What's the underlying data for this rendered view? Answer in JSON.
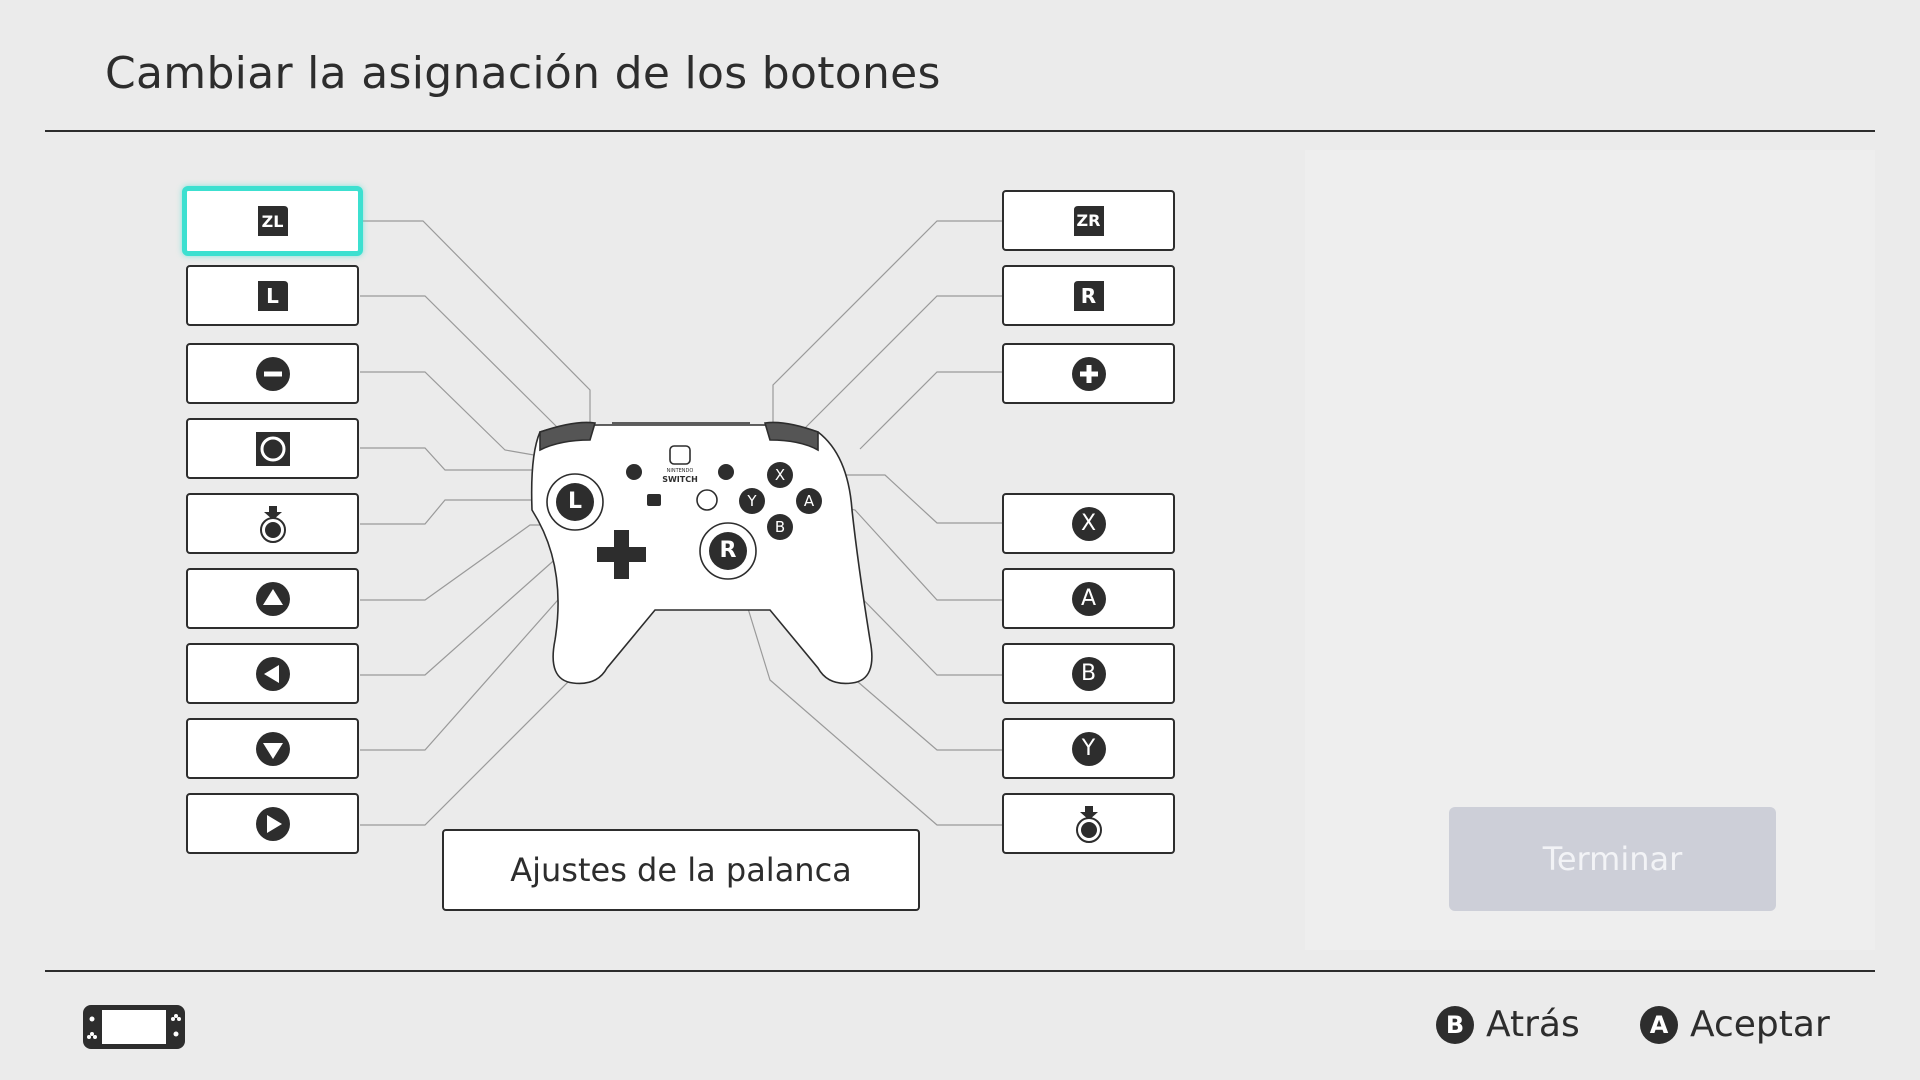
{
  "header": {
    "title": "Cambiar la asignación de los botones"
  },
  "left_buttons": [
    {
      "icon": "zl-button-icon",
      "label": "ZL",
      "selected": true
    },
    {
      "icon": "l-button-icon",
      "label": "L"
    },
    {
      "icon": "minus-button-icon",
      "label": ""
    },
    {
      "icon": "capture-button-icon",
      "label": ""
    },
    {
      "icon": "left-stick-press-icon",
      "label": "L"
    },
    {
      "icon": "dpad-up-icon",
      "label": ""
    },
    {
      "icon": "dpad-left-icon",
      "label": ""
    },
    {
      "icon": "dpad-down-icon",
      "label": ""
    },
    {
      "icon": "dpad-right-icon",
      "label": ""
    }
  ],
  "right_buttons": [
    {
      "icon": "zr-button-icon",
      "label": "ZR"
    },
    {
      "icon": "r-button-icon",
      "label": "R"
    },
    {
      "icon": "plus-button-icon",
      "label": ""
    },
    {
      "icon": "x-button-icon",
      "label": "X"
    },
    {
      "icon": "a-button-icon",
      "label": "A"
    },
    {
      "icon": "b-button-icon",
      "label": "B"
    },
    {
      "icon": "y-button-icon",
      "label": "Y"
    },
    {
      "icon": "right-stick-press-icon",
      "label": "R"
    }
  ],
  "controller": {
    "brand_line1": "NINTENDO",
    "brand_line2": "SWITCH",
    "left_stick": "L",
    "right_stick": "R",
    "face": {
      "x": "X",
      "a": "A",
      "y": "Y",
      "b": "B"
    }
  },
  "stick_settings_label": "Ajustes de la palanca",
  "finish_label": "Terminar",
  "footer": {
    "back": {
      "key": "B",
      "label": "Atrás"
    },
    "accept": {
      "key": "A",
      "label": "Aceptar"
    }
  },
  "colors": {
    "accent": "#3ce0d0",
    "text": "#2d2d2d",
    "disabled_button": "#cdcfd8"
  }
}
